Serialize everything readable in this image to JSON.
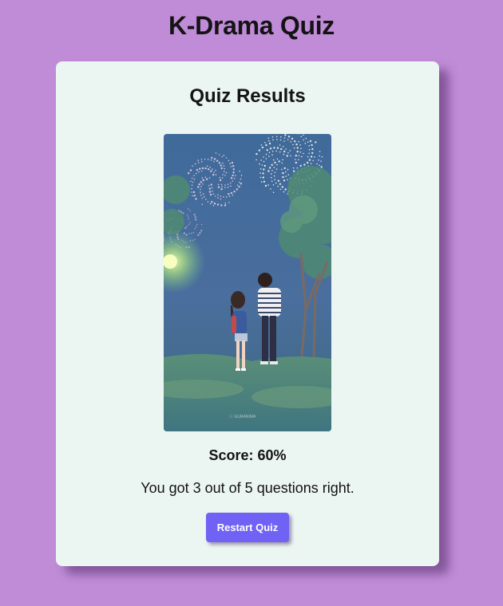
{
  "app": {
    "title": "K-Drama Quiz"
  },
  "results": {
    "title": "Quiz Results",
    "score_text": "Score: 60%",
    "summary_text": "You got 3 out of 5 questions right.",
    "restart_label": "Restart Quiz"
  },
  "illustration": {
    "signature": "ⓒ GURANIMA"
  },
  "colors": {
    "background": "#c08cd8",
    "card": "#ebf5f2",
    "button": "#6f62f5"
  }
}
